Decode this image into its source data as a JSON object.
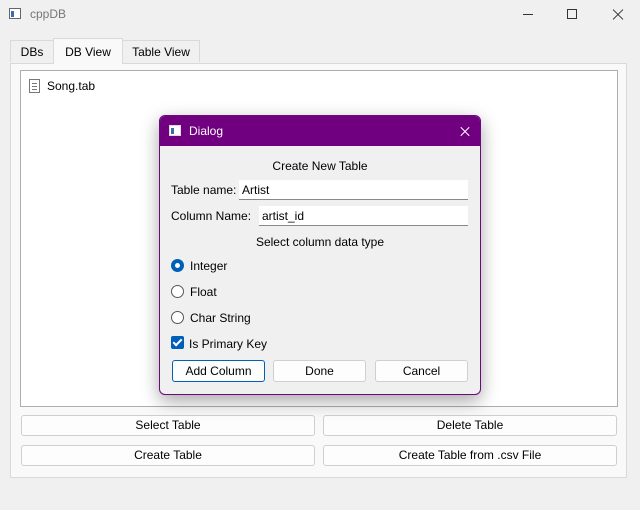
{
  "window": {
    "title": "cppDB"
  },
  "tabs": [
    {
      "label": "DBs",
      "active": false
    },
    {
      "label": "DB View",
      "active": true
    },
    {
      "label": "Table View",
      "active": false
    }
  ],
  "files": [
    {
      "name": "Song.tab",
      "icon": "document-icon"
    }
  ],
  "buttons": {
    "select_table": "Select Table",
    "delete_table": "Delete Table",
    "create_table": "Create Table",
    "create_from_csv": "Create Table from .csv File"
  },
  "dialog": {
    "title": "Dialog",
    "heading": "Create New Table",
    "table_name_label": "Table name:",
    "table_name_value": "Artist",
    "column_name_label": "Column Name:",
    "column_name_value": "artist_id",
    "type_heading": "Select column data type",
    "types": [
      {
        "label": "Integer",
        "checked": true
      },
      {
        "label": "Float",
        "checked": false
      },
      {
        "label": "Char String",
        "checked": false
      }
    ],
    "primary_key_label": "Is Primary Key",
    "primary_key_checked": true,
    "add_column_label": "Add Column",
    "done_label": "Done",
    "cancel_label": "Cancel"
  },
  "colors": {
    "dialog_titlebar": "#700080",
    "accent": "#005fb8"
  }
}
